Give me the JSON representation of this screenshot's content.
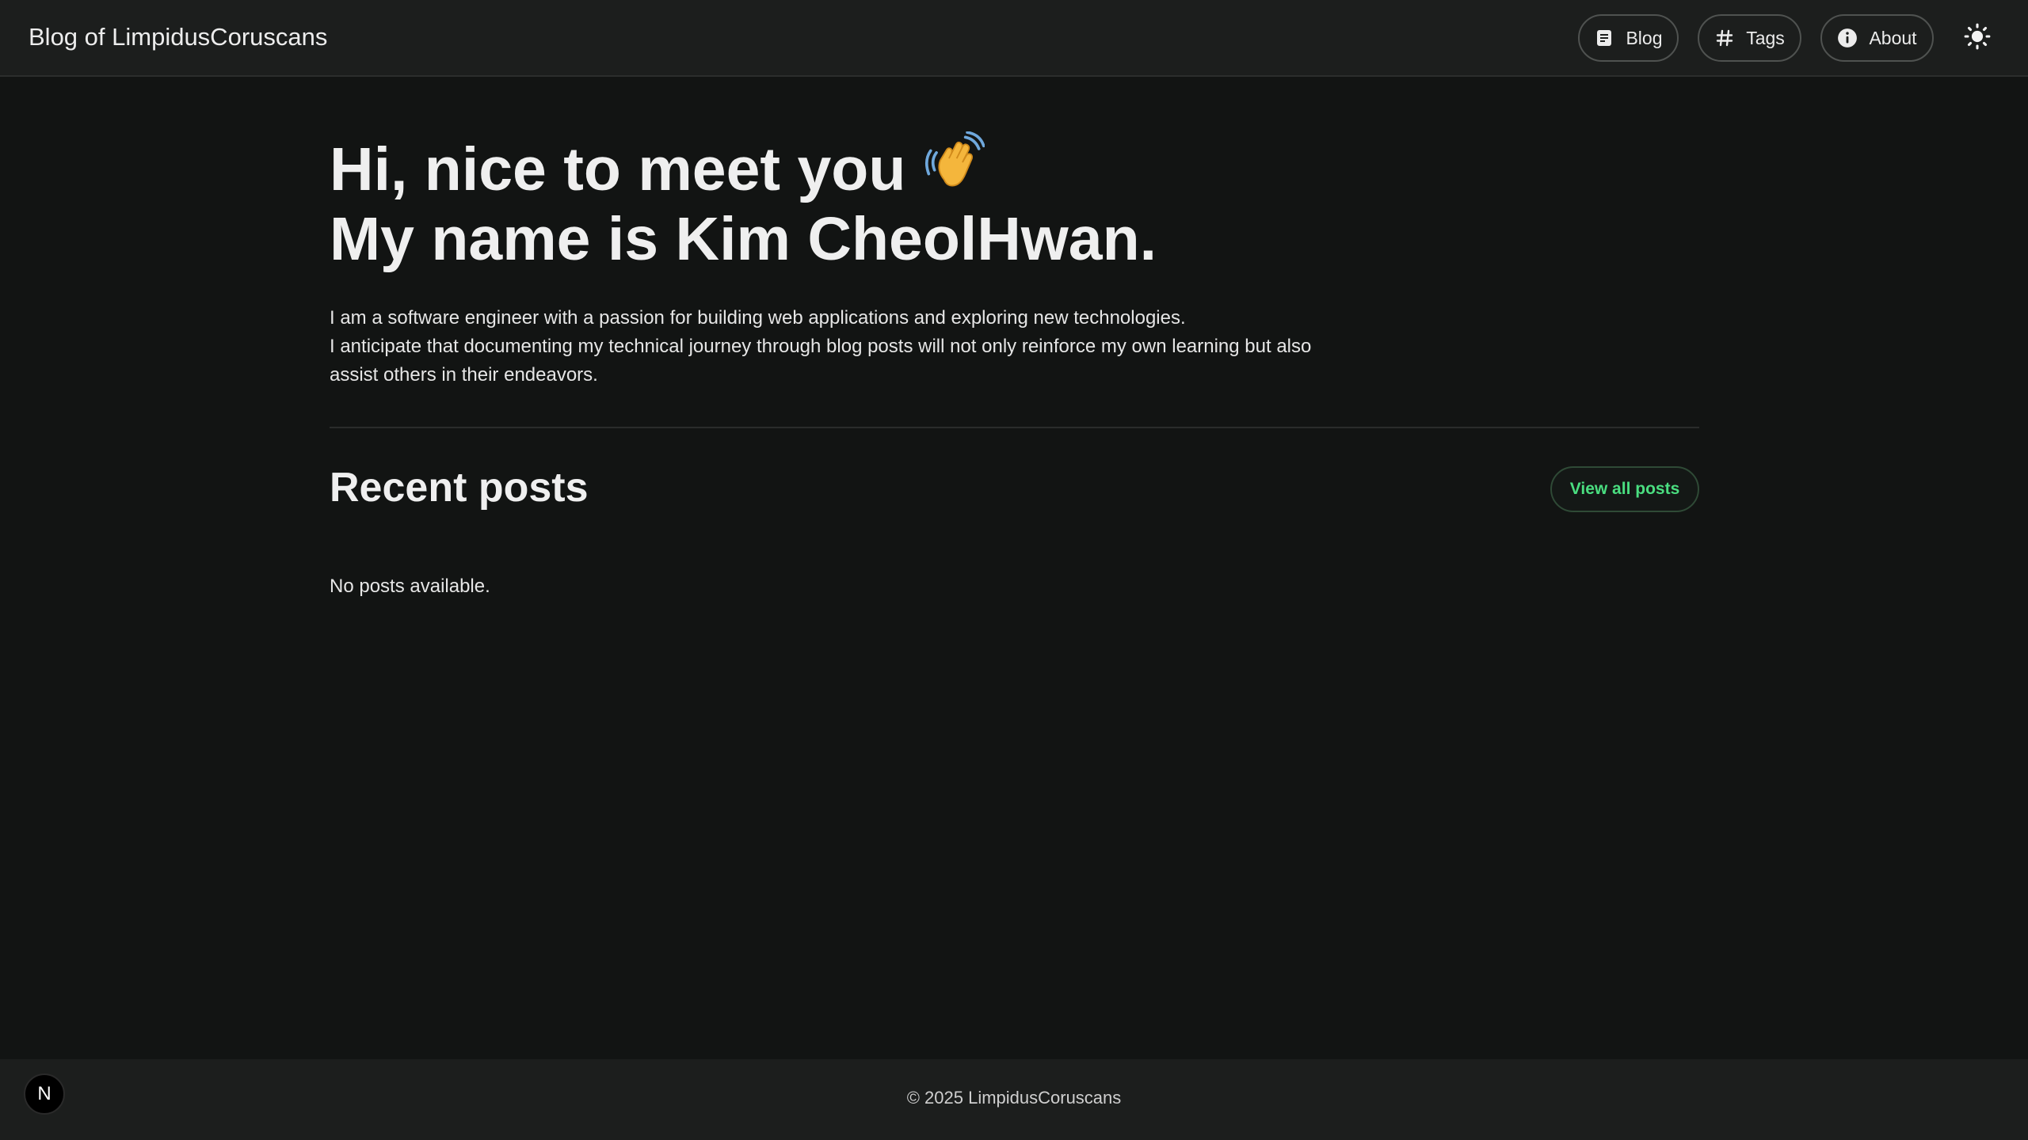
{
  "header": {
    "site_title": "Blog of LimpidusCoruscans",
    "nav": {
      "blog": "Blog",
      "tags": "Tags",
      "about": "About"
    },
    "theme_toggle_icon": "sun-icon"
  },
  "hero": {
    "line1": "Hi, nice to meet you",
    "line2": "My name is Kim CheolHwan.",
    "emoji_icon": "waving-hand-icon"
  },
  "intro": {
    "line1": "I am a software engineer with a passion for building web applications and exploring new technologies.",
    "line2": "I anticipate that documenting my technical journey through blog posts will not only reinforce my own learning but also assist others in their endeavors."
  },
  "recent_posts": {
    "title": "Recent posts",
    "view_all_label": "View all posts",
    "empty_message": "No posts available."
  },
  "footer": {
    "copyright": "© 2025 LimpidusCoruscans",
    "badge_letter": "N"
  },
  "colors": {
    "background": "#121413",
    "header_bg": "#1c1e1d",
    "accent_green": "#4ade80"
  }
}
